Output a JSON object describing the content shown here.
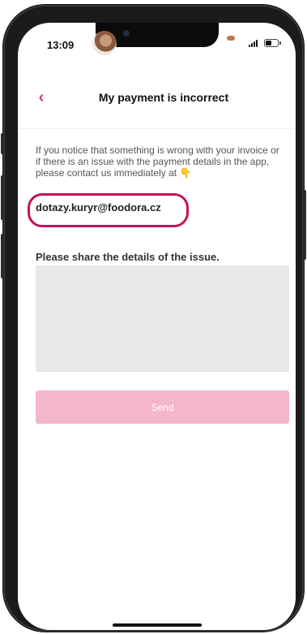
{
  "status_bar": {
    "time": "13:09",
    "icons": [
      "avatar-icon",
      "signal-icon",
      "battery-icon"
    ]
  },
  "header": {
    "back_icon": "chevron-left-icon",
    "back_glyph": "‹",
    "title": "My payment is incorrect"
  },
  "content": {
    "info_text": "If you notice that something is wrong with your invoice or if there is an issue with the payment details in the app, please contact us immediately at",
    "pointing_icon": "pointing-down-hand-icon",
    "pointing_glyph": "👇",
    "email": "dotazy.kuryr@foodora.cz",
    "issue_label": "Please share the details of the issue.",
    "textarea_value": ""
  },
  "actions": {
    "send_label": "Send"
  },
  "colors": {
    "accent": "#d6336c",
    "highlight_ring": "#c4125a",
    "send_disabled": "#f4b6cc",
    "textarea_bg": "#e8e8e8"
  }
}
